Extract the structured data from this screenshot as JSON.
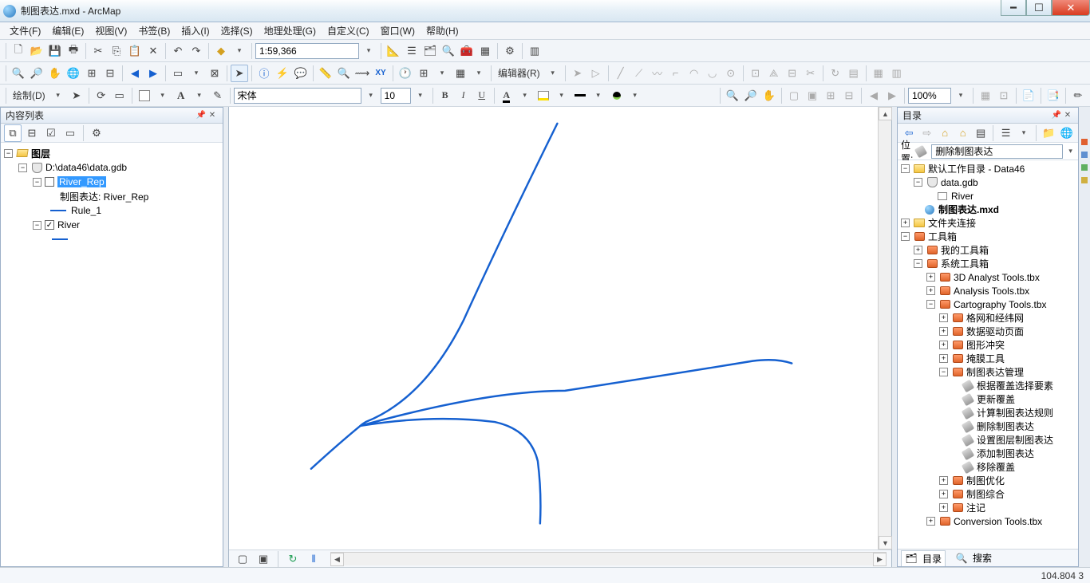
{
  "window": {
    "title": "制图表达.mxd - ArcMap"
  },
  "menu": {
    "file": "文件(F)",
    "edit": "编辑(E)",
    "view": "视图(V)",
    "bookmarks": "书签(B)",
    "insert": "插入(I)",
    "selection": "选择(S)",
    "geoproc": "地理处理(G)",
    "custom": "自定义(C)",
    "window": "窗口(W)",
    "help": "帮助(H)"
  },
  "toolbar1": {
    "scale": "1:59,366"
  },
  "drawbar": {
    "label": "绘制(D)",
    "font": "宋体",
    "size": "10"
  },
  "editor": {
    "label": "编辑器(R)"
  },
  "layout": {
    "zoom": "100%"
  },
  "toc": {
    "title": "内容列表",
    "root": "图层",
    "gdb": "D:\\data46\\data.gdb",
    "river_rep": "River_Rep",
    "rep_label": "制图表达: River_Rep",
    "rule1": "Rule_1",
    "river": "River"
  },
  "catalog": {
    "title": "目录",
    "loc_label": "位置:",
    "loc_value": "删除制图表达",
    "root": "默认工作目录 - Data46",
    "gdb": "data.gdb",
    "river": "River",
    "mxd": "制图表达.mxd",
    "folder_conn": "文件夹连接",
    "toolboxes": "工具箱",
    "my_tbx": "我的工具箱",
    "sys_tbx": "系统工具箱",
    "tbx_3d": "3D Analyst Tools.tbx",
    "tbx_analysis": "Analysis Tools.tbx",
    "tbx_carto": "Cartography Tools.tbx",
    "grp_grid": "格网和经纬网",
    "grp_ddp": "数据驱动页面",
    "grp_conflict": "图形冲突",
    "grp_mask": "掩膜工具",
    "grp_rep": "制图表达管理",
    "t_sel_override": "根据覆盖选择要素",
    "t_update_override": "更新覆盖",
    "t_calc_rule": "计算制图表达规则",
    "t_del_rep": "删除制图表达",
    "t_set_layer": "设置图层制图表达",
    "t_add_rep": "添加制图表达",
    "t_remove_override": "移除覆盖",
    "grp_optimize": "制图优化",
    "grp_generalize": "制图综合",
    "grp_anno": "注记",
    "tbx_conv": "Conversion Tools.tbx",
    "tab_catalog": "目录",
    "tab_search": "搜索"
  },
  "status": {
    "coord": "104.804  3"
  }
}
